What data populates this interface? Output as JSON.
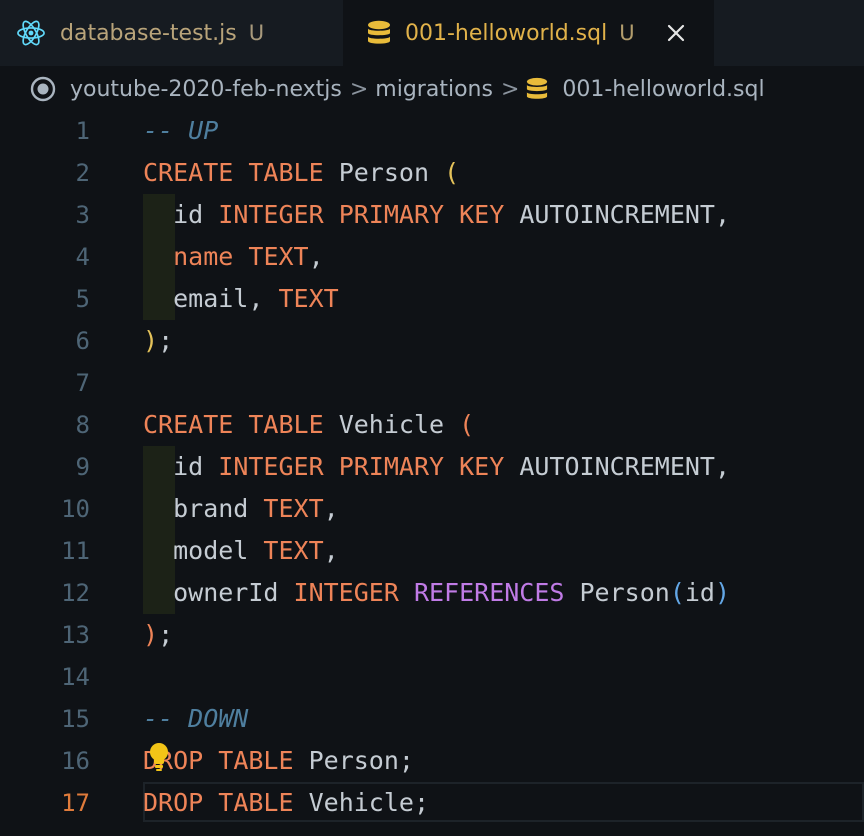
{
  "tabs": [
    {
      "label": "database-test.js",
      "status": "U",
      "icon": "react-icon",
      "active": false
    },
    {
      "label": "001-helloworld.sql",
      "status": "U",
      "icon": "database-icon",
      "active": true
    }
  ],
  "breadcrumb": {
    "items": [
      "youtube-2020-feb-nextjs",
      "migrations",
      "001-helloworld.sql"
    ],
    "separator": ">"
  },
  "editor": {
    "current_line": 17,
    "lines": [
      {
        "n": "1",
        "tokens": [
          [
            "cm",
            "-- UP"
          ]
        ]
      },
      {
        "n": "2",
        "tokens": [
          [
            "kw",
            "CREATE"
          ],
          [
            "plain",
            " "
          ],
          [
            "kw",
            "TABLE"
          ],
          [
            "plain",
            " Person "
          ],
          [
            "br",
            "("
          ]
        ]
      },
      {
        "n": "3",
        "tokens": [
          [
            "plain",
            "  id "
          ],
          [
            "kw",
            "INTEGER"
          ],
          [
            "plain",
            " "
          ],
          [
            "kw",
            "PRIMARY"
          ],
          [
            "plain",
            " "
          ],
          [
            "kw",
            "KEY"
          ],
          [
            "plain",
            " AUTOINCREMENT,"
          ]
        ]
      },
      {
        "n": "4",
        "tokens": [
          [
            "plain",
            "  "
          ],
          [
            "kw",
            "name"
          ],
          [
            "plain",
            " "
          ],
          [
            "kw",
            "TEXT"
          ],
          [
            "plain",
            ","
          ]
        ]
      },
      {
        "n": "5",
        "tokens": [
          [
            "plain",
            "  email, "
          ],
          [
            "kw",
            "TEXT"
          ]
        ]
      },
      {
        "n": "6",
        "tokens": [
          [
            "br",
            ")"
          ],
          [
            "plain",
            ";"
          ]
        ]
      },
      {
        "n": "7",
        "tokens": []
      },
      {
        "n": "8",
        "tokens": [
          [
            "kw",
            "CREATE"
          ],
          [
            "plain",
            " "
          ],
          [
            "kw",
            "TABLE"
          ],
          [
            "plain",
            " Vehicle "
          ],
          [
            "kw",
            "("
          ]
        ]
      },
      {
        "n": "9",
        "tokens": [
          [
            "plain",
            "  id "
          ],
          [
            "kw",
            "INTEGER"
          ],
          [
            "plain",
            " "
          ],
          [
            "kw",
            "PRIMARY"
          ],
          [
            "plain",
            " "
          ],
          [
            "kw",
            "KEY"
          ],
          [
            "plain",
            " AUTOINCREMENT,"
          ]
        ]
      },
      {
        "n": "10",
        "tokens": [
          [
            "plain",
            "  brand "
          ],
          [
            "kw",
            "TEXT"
          ],
          [
            "plain",
            ","
          ]
        ]
      },
      {
        "n": "11",
        "tokens": [
          [
            "plain",
            "  model "
          ],
          [
            "kw",
            "TEXT"
          ],
          [
            "plain",
            ","
          ]
        ]
      },
      {
        "n": "12",
        "tokens": [
          [
            "plain",
            "  ownerId "
          ],
          [
            "kw",
            "INTEGER"
          ],
          [
            "plain",
            " "
          ],
          [
            "fn",
            "REFERENCES"
          ],
          [
            "plain",
            " Person"
          ],
          [
            "pbr",
            "("
          ],
          [
            "plain",
            "id"
          ],
          [
            "pbr",
            ")"
          ]
        ]
      },
      {
        "n": "13",
        "tokens": [
          [
            "kw",
            ")"
          ],
          [
            "plain",
            ";"
          ]
        ]
      },
      {
        "n": "14",
        "tokens": []
      },
      {
        "n": "15",
        "tokens": [
          [
            "cm",
            "-- DOWN"
          ]
        ]
      },
      {
        "n": "16",
        "tokens": [
          [
            "kw",
            "DROP"
          ],
          [
            "plain",
            " "
          ],
          [
            "kw",
            "TABLE"
          ],
          [
            "plain",
            " Person;"
          ]
        ]
      },
      {
        "n": "17",
        "tokens": [
          [
            "kw",
            "DROP"
          ],
          [
            "plain",
            " "
          ],
          [
            "kw",
            "TABLE"
          ],
          [
            "plain",
            " Vehicle;"
          ]
        ]
      }
    ]
  },
  "colors": {
    "keyword": "#ee8458",
    "function": "#c07be6",
    "comment": "#4f7f9f",
    "bracket": "#e4c25a",
    "background": "#0f1216",
    "current_line_number": "#e07b3b"
  }
}
